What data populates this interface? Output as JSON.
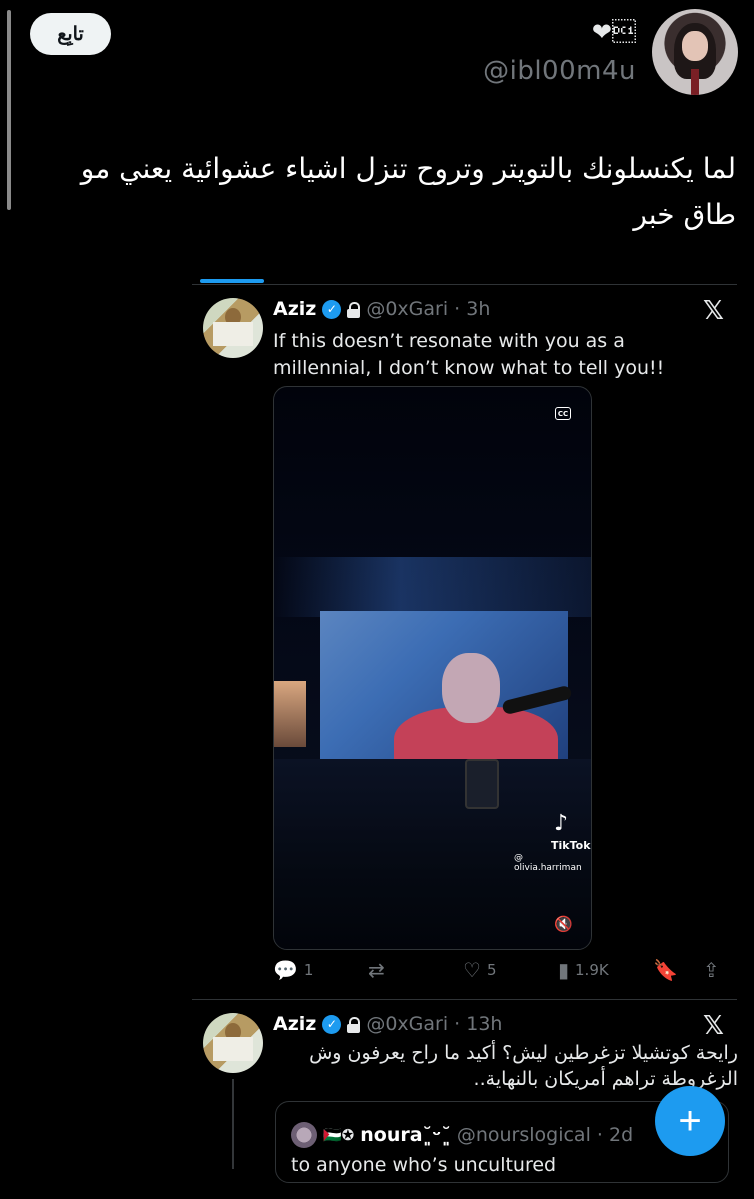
{
  "header": {
    "follow_label": "تابِع",
    "display_name": "❤\u0011",
    "handle": "@ibl00m4u"
  },
  "tweet": {
    "text": "لما يكنسلونك بالتويتر وتروح تنزل اشياء عشوائية يعني مو طاق خبر"
  },
  "quoted_tweet_1": {
    "name": "Aziz",
    "handle_time": "@0xGari · 3h",
    "text": "If this doesn’t resonate with you as a millennial, I don’t know what to tell you!!",
    "media": {
      "cc_label": "CC",
      "tiktok_logo": "♪",
      "tiktok_name": "TikTok",
      "tiktok_user": "@ olivia.harriman"
    },
    "actions": {
      "replies": "1",
      "likes": "5",
      "views": "1.9K"
    }
  },
  "quoted_tweet_2": {
    "name": "Aziz",
    "handle_time": "@0xGari · 13h",
    "text": "رايحة كوتشيلا تزغرطين ليش؟ أكيد ما راح يعرفون وش الزغروطة تراهم أمريكان بالنهاية..",
    "nested": {
      "flags": "🇵🇸✪",
      "name": "noura˘͈ᵕ˘͈",
      "handle_time": "@nourslogical · 2d",
      "text": "to anyone who’s uncultured"
    }
  },
  "fab": {
    "label": "+"
  },
  "colors": {
    "accent": "#1d9bf0",
    "background": "#000000",
    "muted": "#71767b"
  }
}
